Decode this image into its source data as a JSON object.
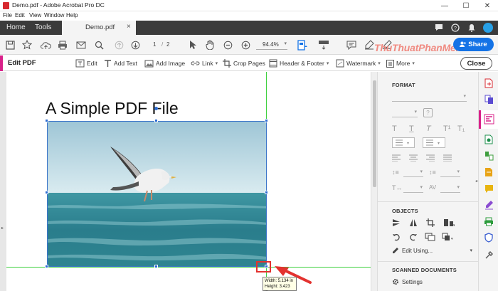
{
  "window": {
    "title": "Demo.pdf - Adobe Acrobat Pro DC",
    "minimize": "—",
    "maximize": "☐",
    "close": "✕"
  },
  "menubar": [
    "File",
    "Edit",
    "View",
    "Window",
    "Help"
  ],
  "tabs": {
    "home": "Home",
    "tools": "Tools",
    "document": "Demo.pdf",
    "document_close": "×"
  },
  "toolbar": {
    "page_current": "1",
    "page_separator": "/",
    "page_total": "2",
    "zoom": "94.4%",
    "share_label": "Share"
  },
  "watermark": "ThuThuatPhanMem.vn",
  "editbar": {
    "title": "Edit PDF",
    "tools": [
      "Edit",
      "Add Text",
      "Add Image",
      "Link",
      "Crop Pages",
      "Header & Footer",
      "Watermark",
      "More"
    ],
    "close_label": "Close"
  },
  "document": {
    "heading": "A Simple PDF File",
    "tooltip_width": "Width: 5.134 in",
    "tooltip_height": "Height: 3.423 in"
  },
  "right_panel": {
    "format_title": "FORMAT",
    "objects_title": "OBJECTS",
    "edit_using": "Edit Using...",
    "scanned_title": "SCANNED DOCUMENTS",
    "settings_label": "Settings"
  },
  "colors": {
    "accent_edit": "#d9218a",
    "share_blue": "#1473e6",
    "guide_green": "#3fd13f",
    "annotation_red": "#e3322f"
  }
}
